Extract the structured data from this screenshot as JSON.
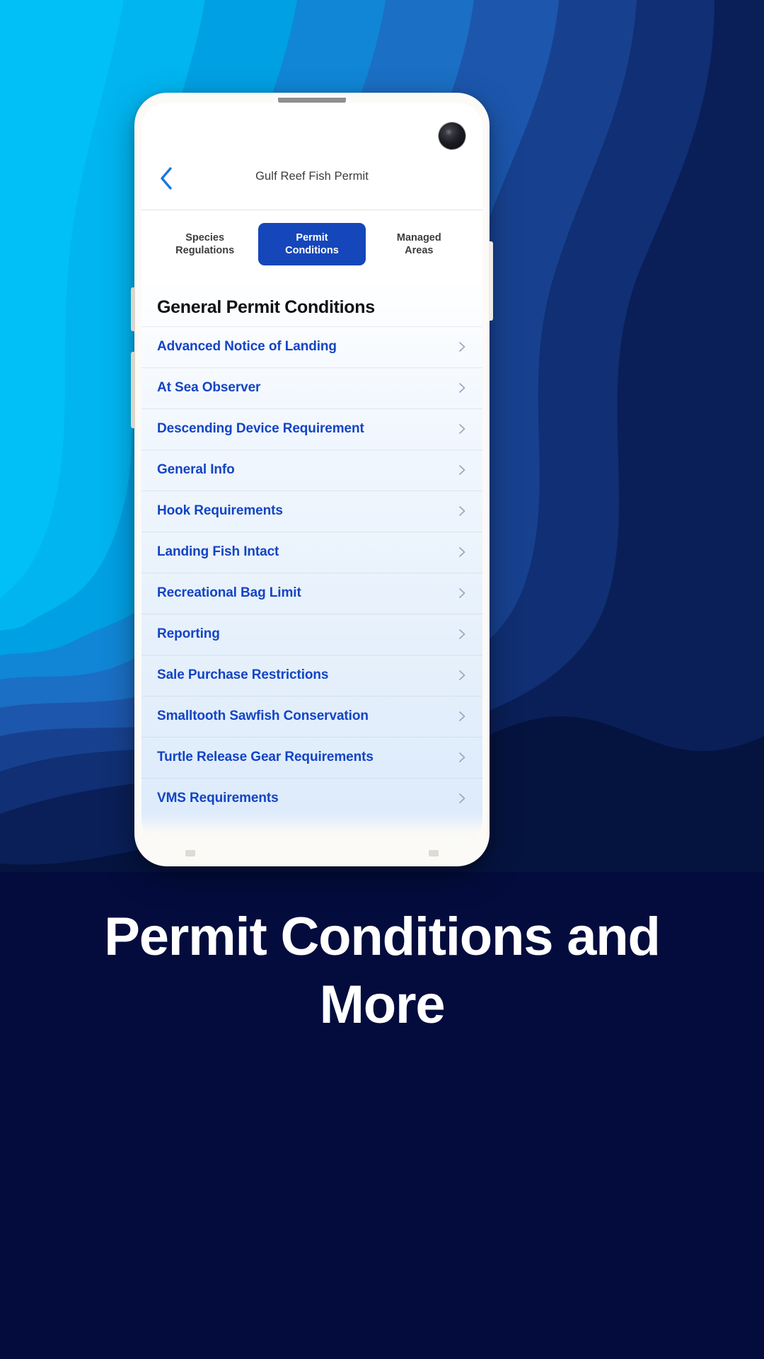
{
  "theme": {
    "accent_blue": "#1546ba",
    "link_blue": "#1344c4",
    "page_background": "#030c3d",
    "wave_colors": [
      "#00b5f0",
      "#00a0e4",
      "#1186d6",
      "#1b6fc4",
      "#1c57ad",
      "#17418f",
      "#102f74",
      "#0a1f57",
      "#05133f"
    ]
  },
  "phone": {
    "camera_icon": "camera-lens-icon",
    "speaker_icon": "earpiece-speaker-icon"
  },
  "header": {
    "back_icon": "chevron-left-icon",
    "title": "Gulf Reef Fish Permit"
  },
  "tabs": [
    {
      "label": "Species\nRegulations",
      "name": "tab-species-regulations",
      "active": false
    },
    {
      "label": "Permit\nConditions",
      "name": "tab-permit-conditions",
      "active": true
    },
    {
      "label": "Managed\nAreas",
      "name": "tab-managed-areas",
      "active": false
    }
  ],
  "main": {
    "section_title": "General Permit Conditions",
    "chevron_icon": "chevron-right-icon",
    "items": [
      {
        "label": "Advanced Notice of Landing"
      },
      {
        "label": "At Sea Observer"
      },
      {
        "label": "Descending Device Requirement"
      },
      {
        "label": "General Info"
      },
      {
        "label": "Hook Requirements"
      },
      {
        "label": "Landing Fish Intact"
      },
      {
        "label": "Recreational Bag Limit"
      },
      {
        "label": "Reporting"
      },
      {
        "label": "Sale Purchase Restrictions"
      },
      {
        "label": "Smalltooth Sawfish Conservation"
      },
      {
        "label": "Turtle Release Gear Requirements"
      },
      {
        "label": "VMS Requirements"
      }
    ]
  },
  "caption": {
    "text": "Permit Conditions and More"
  }
}
